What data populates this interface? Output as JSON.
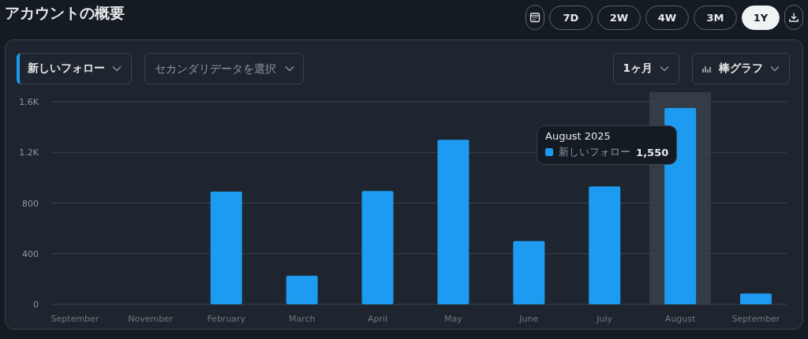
{
  "header": {
    "title": "アカウントの概要",
    "ranges": [
      {
        "label": "7D",
        "selected": false
      },
      {
        "label": "2W",
        "selected": false
      },
      {
        "label": "4W",
        "selected": false
      },
      {
        "label": "3M",
        "selected": false
      },
      {
        "label": "1Y",
        "selected": true
      }
    ]
  },
  "controls": {
    "metric": "新しいフォロー",
    "secondary": {
      "placeholder": "セカンダリデータを選択"
    },
    "interval": "1ヶ月",
    "chart_type": "棒グラフ"
  },
  "tooltip": {
    "title": "August 2025",
    "value": "1,550"
  },
  "chart_data": {
    "type": "bar",
    "categories": [
      "September",
      "November",
      "February",
      "March",
      "April",
      "May",
      "June",
      "July",
      "August",
      "September"
    ],
    "series": [
      {
        "name": "新しいフォロー",
        "color": "#1d9bf0",
        "values": [
          null,
          null,
          890,
          225,
          895,
          1300,
          500,
          930,
          1550,
          85
        ]
      }
    ],
    "ylim": [
      0,
      1600
    ],
    "yticks": [
      {
        "value": 0,
        "label": "0"
      },
      {
        "value": 400,
        "label": "400"
      },
      {
        "value": 800,
        "label": "800"
      },
      {
        "value": 1200,
        "label": "1.2K"
      },
      {
        "value": 1600,
        "label": "1.6K"
      }
    ],
    "grid": true
  }
}
